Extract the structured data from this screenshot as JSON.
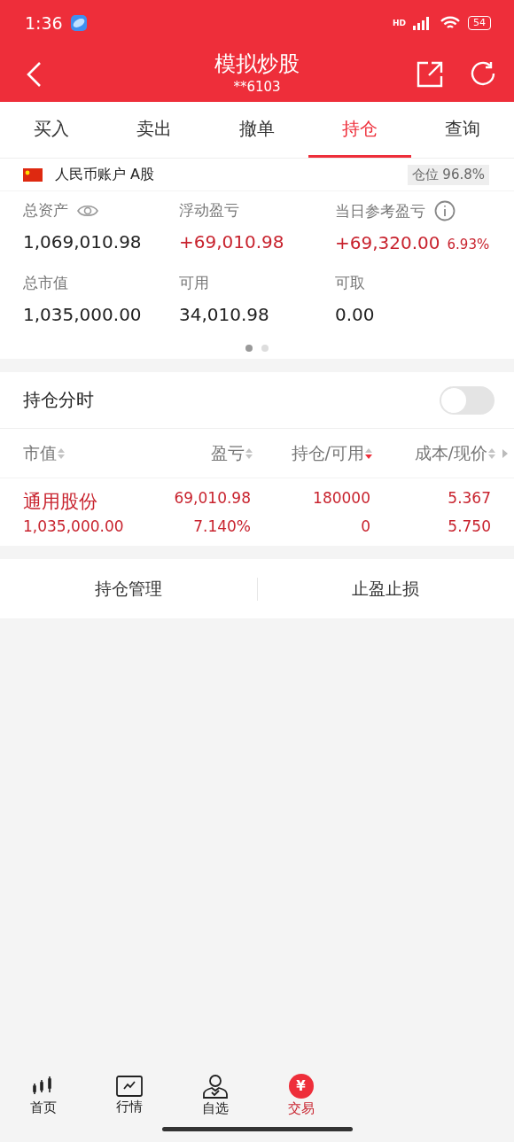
{
  "status_bar": {
    "time": "1:36",
    "network": "HD",
    "battery": "54"
  },
  "header": {
    "title": "模拟炒股",
    "subtitle": "**6103"
  },
  "tabs": [
    {
      "label": "买入",
      "selected": false
    },
    {
      "label": "卖出",
      "selected": false
    },
    {
      "label": "撤单",
      "selected": false
    },
    {
      "label": "持仓",
      "selected": true
    },
    {
      "label": "查询",
      "selected": false
    }
  ],
  "account": {
    "name": "人民币账户 A股",
    "position_label": "仓位",
    "position_value": "96.8%"
  },
  "metrics": [
    {
      "label": "总资产",
      "value": "1,069,010.98",
      "kind": "plain"
    },
    {
      "label": "浮动盈亏",
      "value": "+69,010.98",
      "kind": "gain"
    },
    {
      "label": "当日参考盈亏",
      "value": "+69,320.00",
      "extra": "6.93%",
      "kind": "gain"
    },
    {
      "label": "总市值",
      "value": "1,035,000.00",
      "kind": "plain"
    },
    {
      "label": "可用",
      "value": "34,010.98",
      "kind": "plain"
    },
    {
      "label": "可取",
      "value": "0.00",
      "kind": "plain"
    }
  ],
  "pager": [
    {
      "selected": true
    },
    {
      "selected": false
    }
  ],
  "timeshare": {
    "label": "持仓分时",
    "on": false
  },
  "columns": [
    {
      "label": "市值",
      "sorted": false
    },
    {
      "label": "盈亏",
      "sorted": false
    },
    {
      "label": "持仓/可用",
      "sorted": true
    },
    {
      "label": "成本/现价",
      "sorted": false
    }
  ],
  "holdings": [
    {
      "name": "通用股份",
      "market_value": "1,035,000.00",
      "pnl": "69,010.98",
      "pnl_pct": "7.140%",
      "shares": "180000",
      "available": "0",
      "cost": "5.367",
      "price": "5.750"
    }
  ],
  "actions": [
    "持仓管理",
    "止盈止损"
  ],
  "nav": [
    {
      "label": "首页",
      "kind": "candles",
      "selected": false
    },
    {
      "label": "行情",
      "kind": "chart",
      "selected": false
    },
    {
      "label": "自选",
      "kind": "person",
      "selected": false
    },
    {
      "label": "交易",
      "kind": "yen",
      "glyph": "¥",
      "selected": true
    }
  ]
}
